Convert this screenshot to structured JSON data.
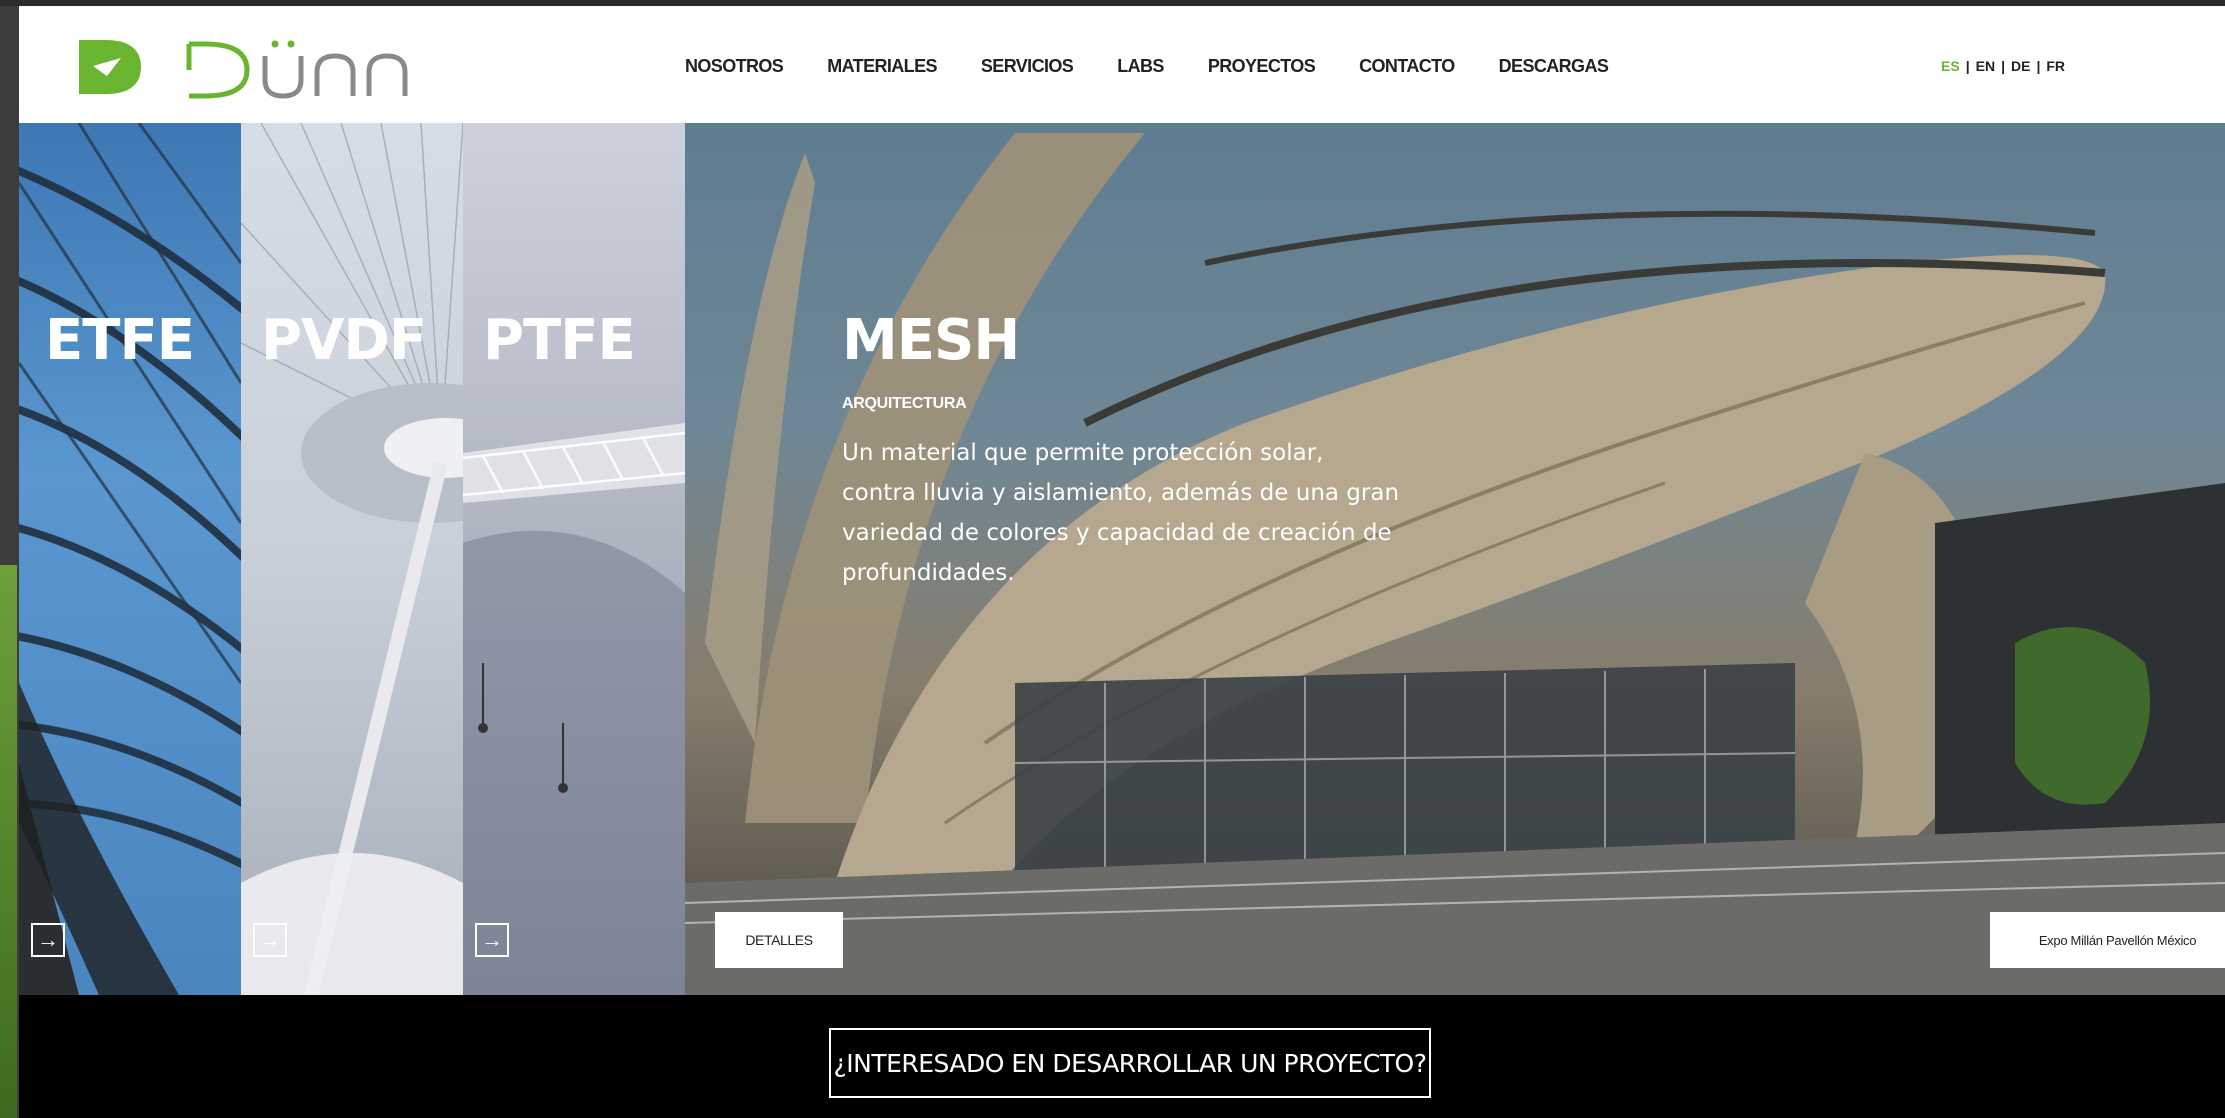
{
  "brand": {
    "logo_text": "DÜNN",
    "accent_color": "#6ab530"
  },
  "nav": {
    "items": [
      {
        "label": "NOSOTROS"
      },
      {
        "label": "MATERIALES"
      },
      {
        "label": "SERVICIOS"
      },
      {
        "label": "LABS"
      },
      {
        "label": "PROYECTOS"
      },
      {
        "label": "CONTACTO"
      },
      {
        "label": "DESCARGAS"
      }
    ]
  },
  "languages": {
    "items": [
      "ES",
      "EN",
      "DE",
      "FR"
    ],
    "active": "ES",
    "separator": "|"
  },
  "panels": {
    "etfe": {
      "title": "ETFE",
      "arrow_icon": "arrow-right-icon"
    },
    "pvdf": {
      "title": "PVDF",
      "arrow_icon": "arrow-right-icon"
    },
    "ptfe": {
      "title": "PTFE",
      "arrow_icon": "arrow-right-icon"
    },
    "mesh": {
      "title": "MESH",
      "subtitle": "ARQUITECTURA",
      "description": "Un material que permite protección solar, contra lluvia y aislamiento, además de una gran variedad de colores y capacidad de creación de profundidades.",
      "details_label": "DETALLES",
      "project_caption": "Expo Millán Pavellón México"
    }
  },
  "cta": {
    "label": "¿INTERESADO EN DESARROLLAR UN PROYECTO?"
  }
}
